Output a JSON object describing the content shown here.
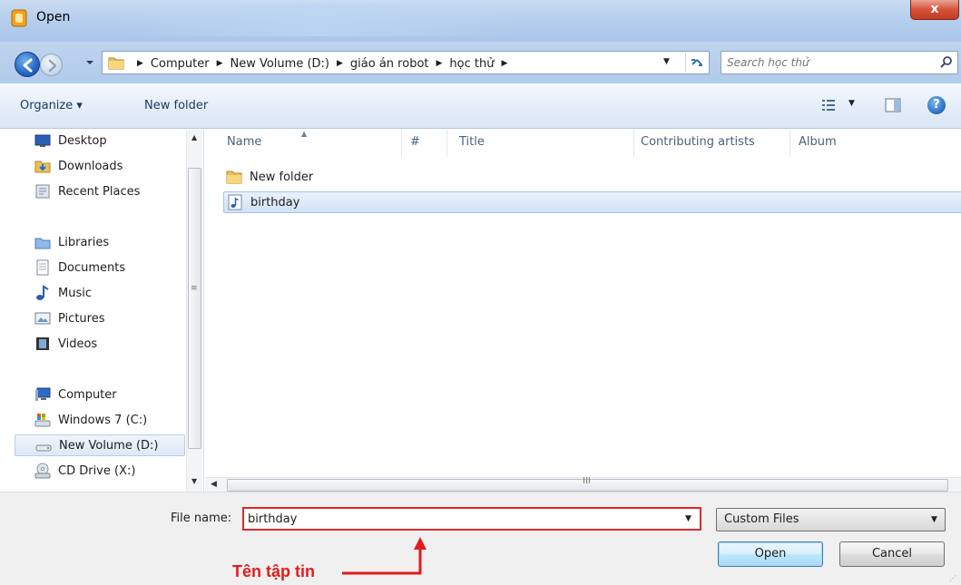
{
  "window": {
    "title": "Open",
    "close_label": "x"
  },
  "address": {
    "crumbs": [
      "Computer",
      "New Volume (D:)",
      "giáo án robot",
      "học thử"
    ],
    "search_placeholder": "Search học thử"
  },
  "toolbar": {
    "organize": "Organize ▾",
    "new_folder": "New folder"
  },
  "nav": {
    "favorites": [
      {
        "label": "Desktop",
        "icon": "desktop-icon"
      },
      {
        "label": "Downloads",
        "icon": "downloads-icon"
      },
      {
        "label": "Recent Places",
        "icon": "recent-places-icon"
      }
    ],
    "libraries_label": "Libraries",
    "libraries": [
      {
        "label": "Documents",
        "icon": "documents-icon"
      },
      {
        "label": "Music",
        "icon": "music-icon"
      },
      {
        "label": "Pictures",
        "icon": "pictures-icon"
      },
      {
        "label": "Videos",
        "icon": "videos-icon"
      }
    ],
    "computer_label": "Computer",
    "drives": [
      {
        "label": "Windows 7 (C:)",
        "icon": "drive-icon"
      },
      {
        "label": "New Volume (D:)",
        "icon": "drive-icon",
        "selected": true
      },
      {
        "label": "CD Drive (X:)",
        "icon": "cd-drive-icon"
      }
    ]
  },
  "columns": [
    "Name",
    "#",
    "Title",
    "Contributing artists",
    "Album"
  ],
  "files": [
    {
      "name": "New folder",
      "icon": "folder-icon"
    },
    {
      "name": "birthday",
      "icon": "audio-file-icon",
      "selected": true
    }
  ],
  "footer": {
    "file_name_label": "File name:",
    "file_name_value": "birthday",
    "file_type": "Custom Files",
    "open_label": "Open",
    "cancel_label": "Cancel",
    "scroll_grip": "III"
  },
  "annotation": {
    "text": "Tên tập tin",
    "color": "#e31b1b"
  },
  "colors": {
    "accent": "#e0292b",
    "selection": "#d2e2f5",
    "titlebar": "#b7cfee"
  }
}
